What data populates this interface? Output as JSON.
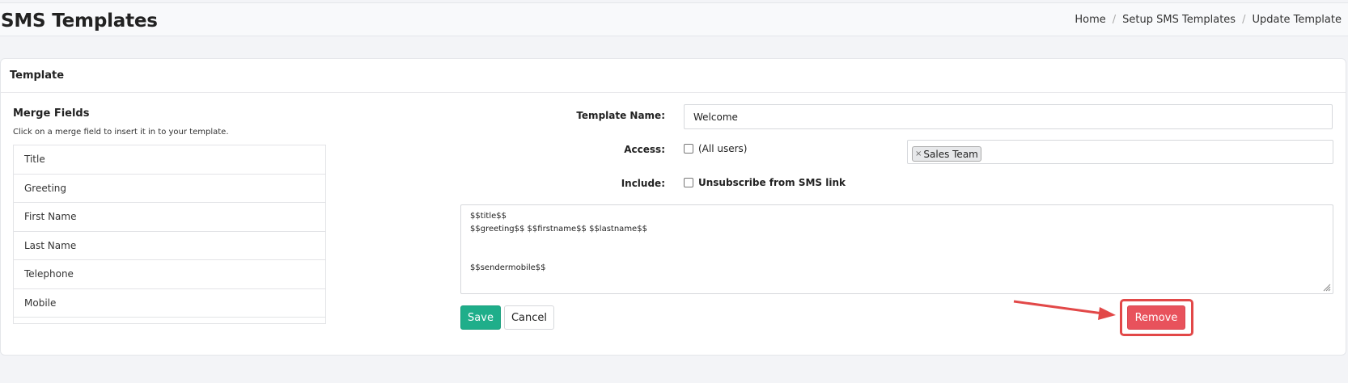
{
  "header": {
    "title": "SMS Templates",
    "breadcrumb": [
      "Home",
      "Setup SMS Templates",
      "Update Template"
    ],
    "separator": "/"
  },
  "card": {
    "title": "Template"
  },
  "merge_fields": {
    "title": "Merge Fields",
    "hint": "Click on a merge field to insert it in to your template.",
    "items": [
      "Title",
      "Greeting",
      "First Name",
      "Last Name",
      "Telephone",
      "Mobile"
    ]
  },
  "form": {
    "template_name_label": "Template Name:",
    "template_name_value": "Welcome",
    "access_label": "Access:",
    "all_users_label": "(All users)",
    "access_tag": "Sales Team",
    "tag_remove_glyph": "×",
    "include_label": "Include:",
    "unsubscribe_label": "Unsubscribe from SMS link",
    "body_lines": [
      "$$title$$",
      "$$greeting$$ $$firstname$$ $$lastname$$",
      "",
      "",
      "$$sendermobile$$"
    ]
  },
  "buttons": {
    "save": "Save",
    "cancel": "Cancel",
    "remove": "Remove"
  },
  "colors": {
    "save": "#1fae8a",
    "remove": "#e8525c",
    "annotation": "#e24848"
  }
}
